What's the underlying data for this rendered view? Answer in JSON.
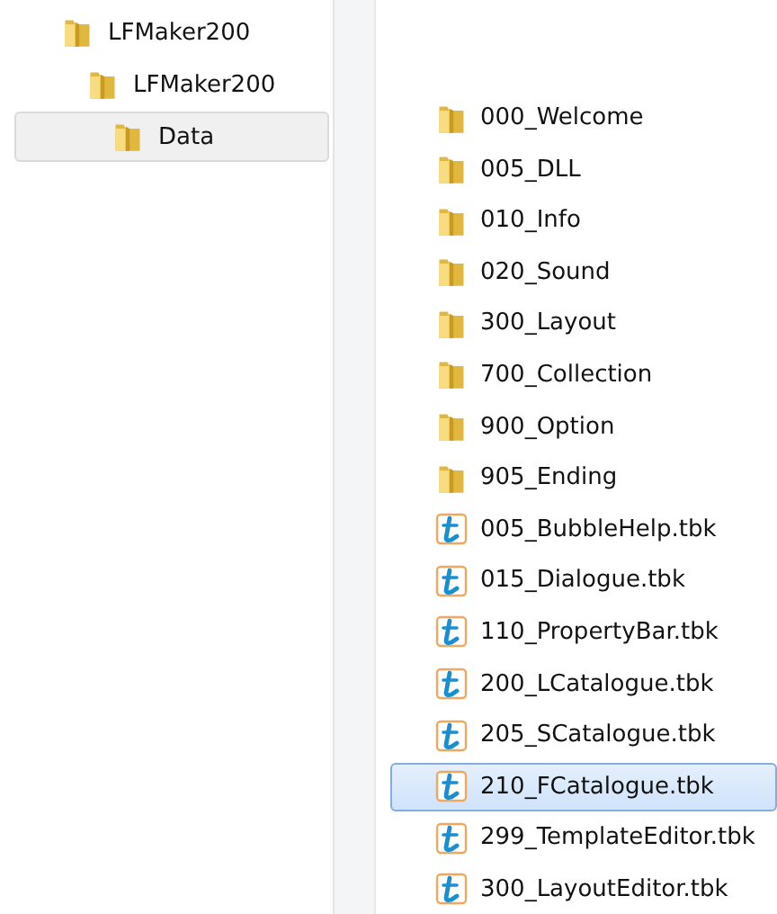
{
  "tree": [
    {
      "label": "LFMaker200",
      "selected": false,
      "children": [
        {
          "label": "LFMaker200",
          "selected": false,
          "children": [
            {
              "label": "Data",
              "selected": true
            }
          ]
        }
      ]
    }
  ],
  "files": [
    {
      "name": "000_Welcome",
      "kind": "folder",
      "selected": false
    },
    {
      "name": "005_DLL",
      "kind": "folder",
      "selected": false
    },
    {
      "name": "010_Info",
      "kind": "folder",
      "selected": false
    },
    {
      "name": "020_Sound",
      "kind": "folder",
      "selected": false
    },
    {
      "name": "300_Layout",
      "kind": "folder",
      "selected": false
    },
    {
      "name": "700_Collection",
      "kind": "folder",
      "selected": false
    },
    {
      "name": "900_Option",
      "kind": "folder",
      "selected": false
    },
    {
      "name": "905_Ending",
      "kind": "folder",
      "selected": false
    },
    {
      "name": "005_BubbleHelp.tbk",
      "kind": "book",
      "selected": false
    },
    {
      "name": "015_Dialogue.tbk",
      "kind": "book",
      "selected": false
    },
    {
      "name": "110_PropertyBar.tbk",
      "kind": "book",
      "selected": false
    },
    {
      "name": "200_LCatalogue.tbk",
      "kind": "book",
      "selected": false
    },
    {
      "name": "205_SCatalogue.tbk",
      "kind": "book",
      "selected": false
    },
    {
      "name": "210_FCatalogue.tbk",
      "kind": "book",
      "selected": true
    },
    {
      "name": "299_TemplateEditor.tbk",
      "kind": "book",
      "selected": false
    },
    {
      "name": "300_LayoutEditor.tbk",
      "kind": "book",
      "selected": false
    }
  ]
}
